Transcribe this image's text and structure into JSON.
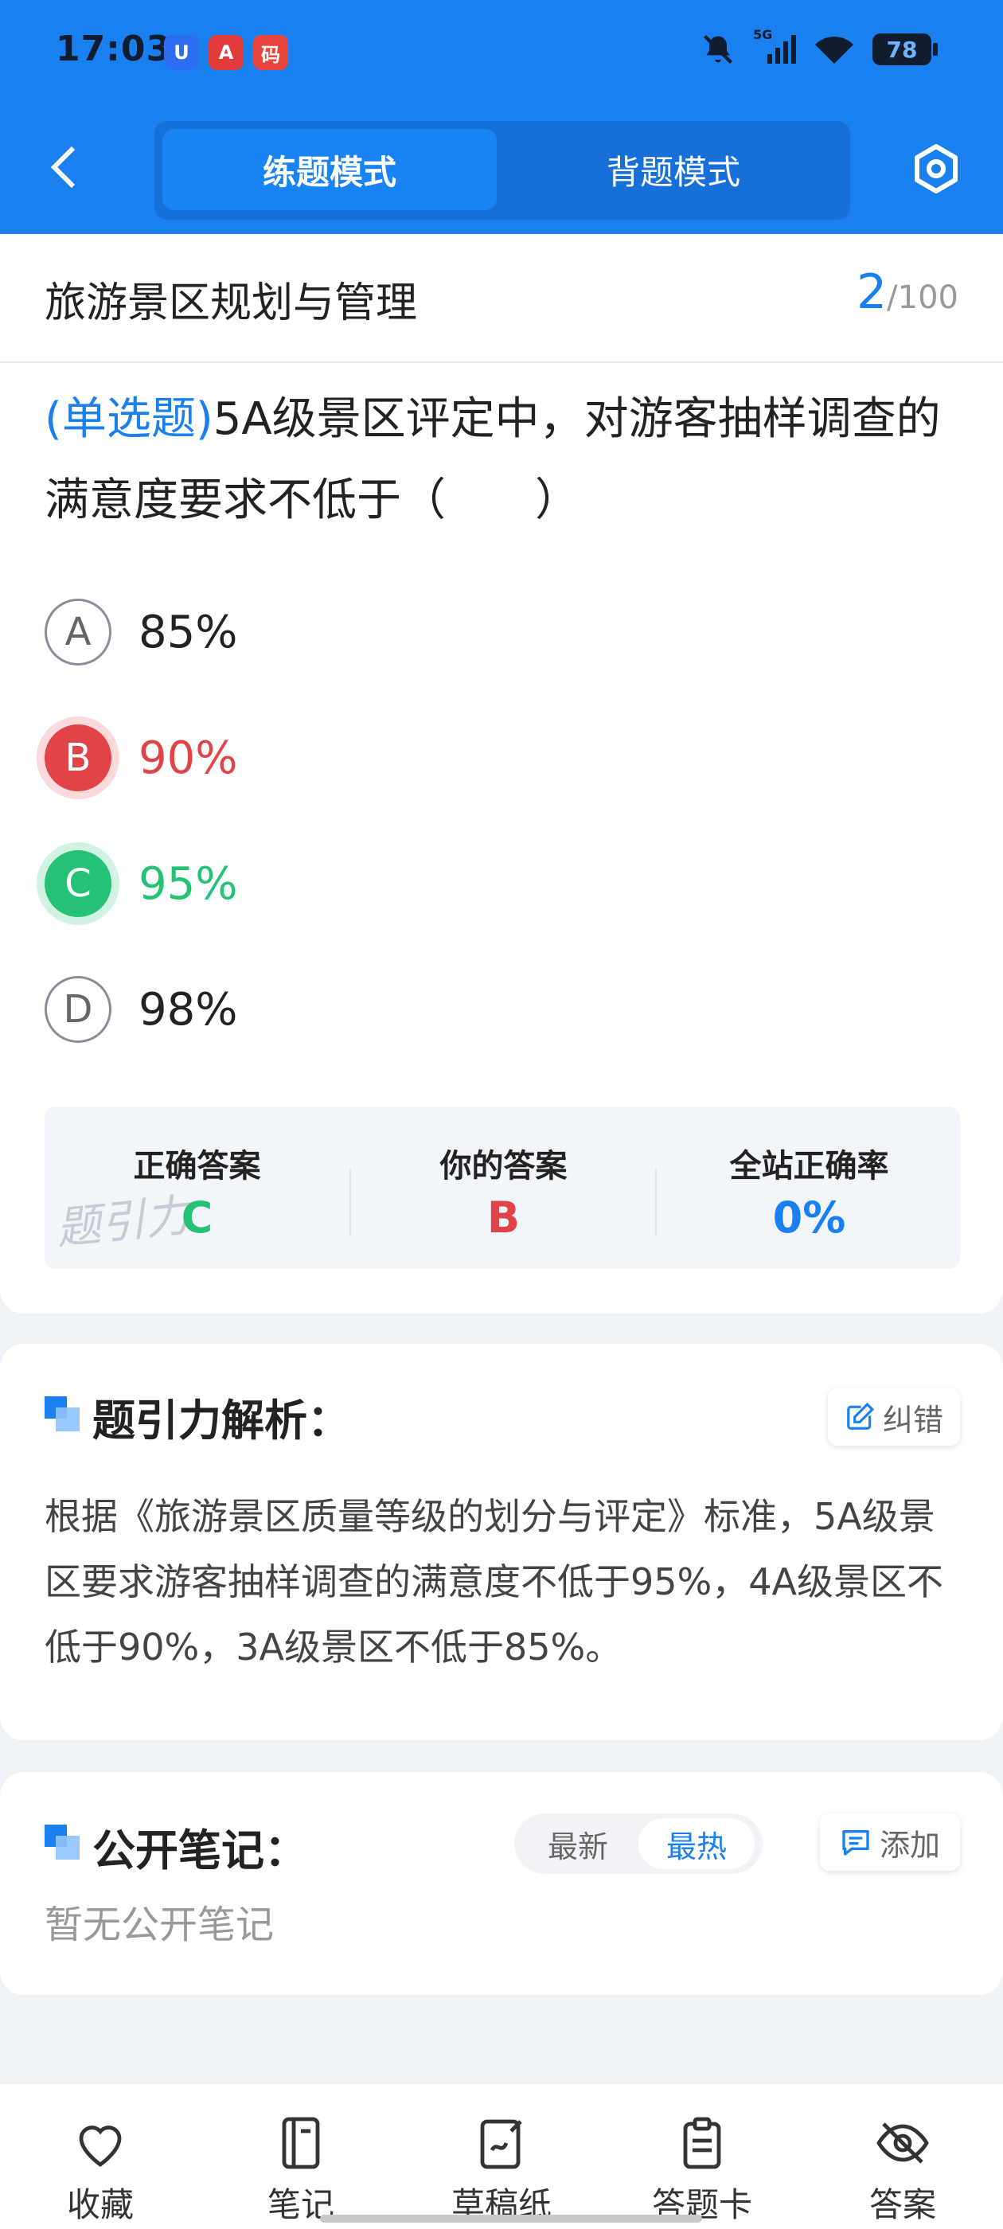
{
  "status_bar": {
    "time": "17:03",
    "apps": [
      "U",
      "A",
      "码"
    ],
    "network": "5G",
    "battery": "78"
  },
  "header": {
    "back_icon": "chevron-left-icon",
    "tabs": [
      {
        "label": "练题模式",
        "active": true
      },
      {
        "label": "背题模式",
        "active": false
      }
    ],
    "settings_icon": "hexagon-settings-icon"
  },
  "subject": {
    "title": "旅游景区规划与管理",
    "current": "2",
    "total": "/100"
  },
  "question": {
    "type": "(单选题)",
    "text": "5A级景区评定中，对游客抽样调查的满意度要求不低于（　　）",
    "options": [
      {
        "letter": "A",
        "text": "85%",
        "state": "normal"
      },
      {
        "letter": "B",
        "text": "90%",
        "state": "wrong"
      },
      {
        "letter": "C",
        "text": "95%",
        "state": "correct"
      },
      {
        "letter": "D",
        "text": "98%",
        "state": "normal"
      }
    ]
  },
  "answer_summary": {
    "correct_label": "正确答案",
    "correct_value": "C",
    "yours_label": "你的答案",
    "yours_value": "B",
    "rate_label": "全站正确率",
    "rate_value": "0%",
    "watermark": "题引力"
  },
  "analysis": {
    "title": "题引力解析：",
    "report_label": "纠错",
    "body": "根据《旅游景区质量等级的划分与评定》标准，5A级景区要求游客抽样调查的满意度不低于95%，4A级景区不低于90%，3A级景区不低于85%。"
  },
  "notes": {
    "title": "公开笔记：",
    "tab_new": "最新",
    "tab_hot": "最热",
    "add_label": "添加",
    "empty": "暂无公开笔记"
  },
  "bottom_nav": [
    {
      "label": "收藏",
      "icon": "heart-icon"
    },
    {
      "label": "笔记",
      "icon": "notebook-icon"
    },
    {
      "label": "草稿纸",
      "icon": "draft-paper-icon"
    },
    {
      "label": "答题卡",
      "icon": "clipboard-icon"
    },
    {
      "label": "答案",
      "icon": "eye-off-icon"
    }
  ],
  "colors": {
    "primary": "#1a80f0",
    "wrong": "#e04448",
    "correct": "#25c275"
  }
}
